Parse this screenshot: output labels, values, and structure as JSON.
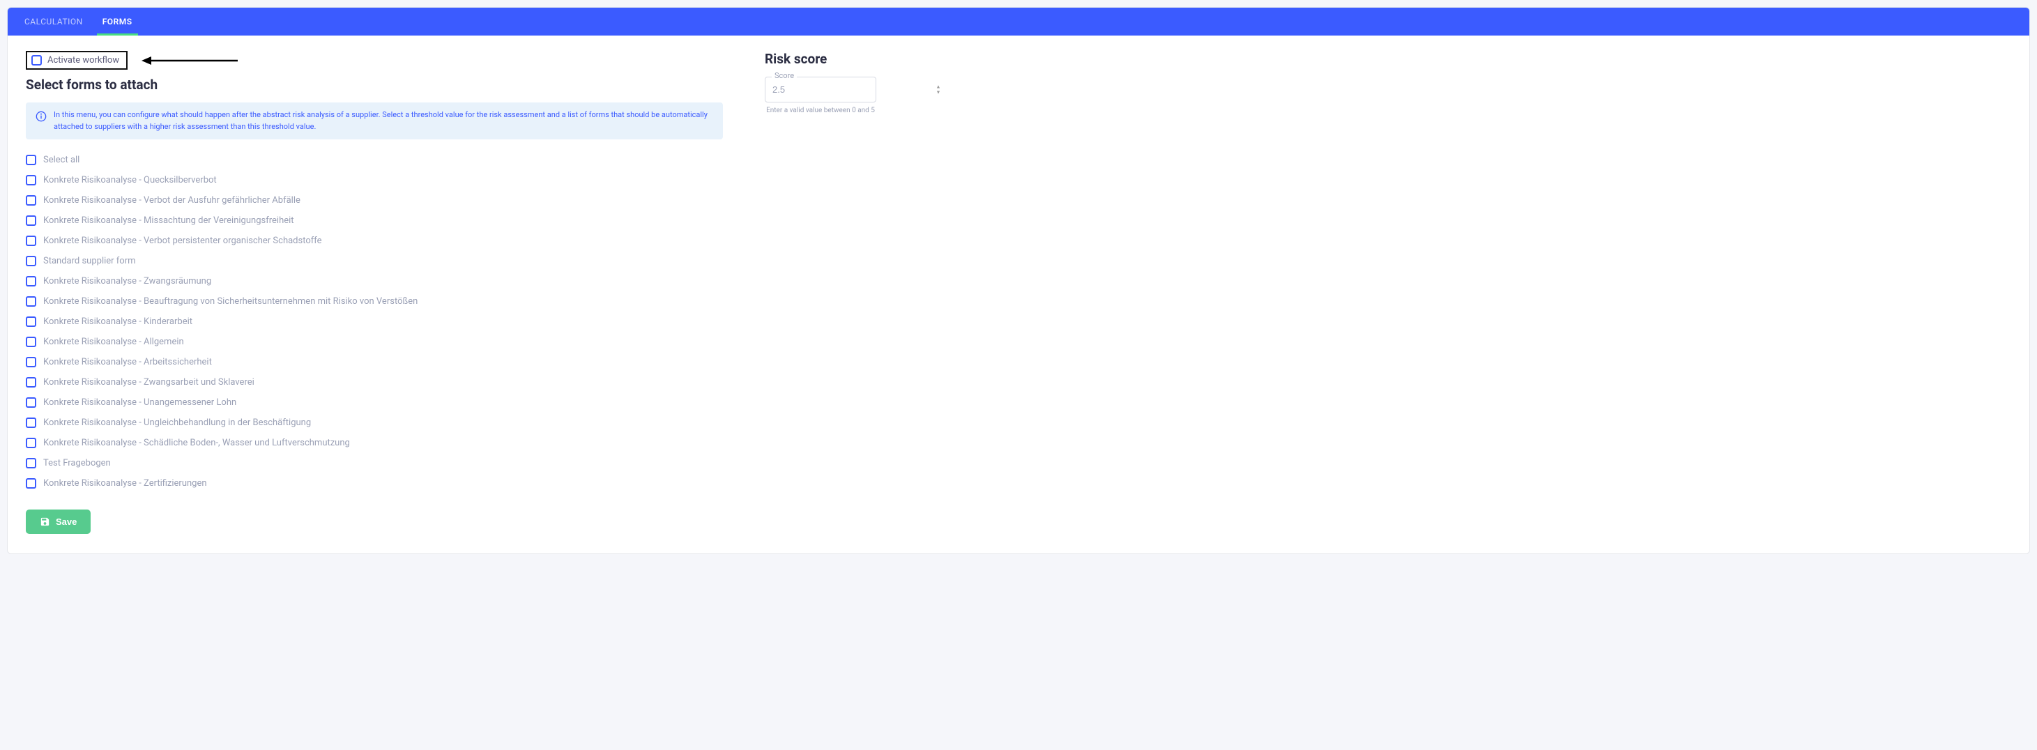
{
  "tabs": {
    "calculation": "CALCULATION",
    "forms": "FORMS"
  },
  "activate": {
    "label": "Activate workflow"
  },
  "section": {
    "title": "Select forms to attach",
    "info": "In this menu, you can configure what should happen after the abstract risk analysis of a supplier. Select a threshold value for the risk assessment and a list of forms that should be automatically attached to suppliers with a higher risk assessment than this threshold value."
  },
  "forms": [
    "Select all",
    "Konkrete Risikoanalyse - Quecksilberverbot",
    "Konkrete Risikoanalyse - Verbot der Ausfuhr gefährlicher Abfälle",
    "Konkrete Risikoanalyse - Missachtung der Vereinigungsfreiheit",
    "Konkrete Risikoanalyse - Verbot persistenter organischer Schadstoffe",
    "Standard supplier form",
    "Konkrete Risikoanalyse - Zwangsräumung",
    "Konkrete Risikoanalyse - Beauftragung von Sicherheitsunternehmen mit Risiko von Verstößen",
    "Konkrete Risikoanalyse - Kinderarbeit",
    "Konkrete Risikoanalyse - Allgemein",
    "Konkrete Risikoanalyse - Arbeitssicherheit",
    "Konkrete Risikoanalyse - Zwangsarbeit und Sklaverei",
    "Konkrete Risikoanalyse - Unangemessener Lohn",
    "Konkrete Risikoanalyse - Ungleichbehandlung in der Beschäftigung",
    "Konkrete Risikoanalyse - Schädliche Boden-, Wasser und Luftverschmutzung",
    "Test Fragebogen",
    "Konkrete Risikoanalyse - Zertifizierungen"
  ],
  "risk": {
    "title": "Risk score",
    "field_label": "Score",
    "placeholder": "2.5",
    "helper": "Enter a valid value between 0 and 5"
  },
  "buttons": {
    "save": "Save"
  }
}
